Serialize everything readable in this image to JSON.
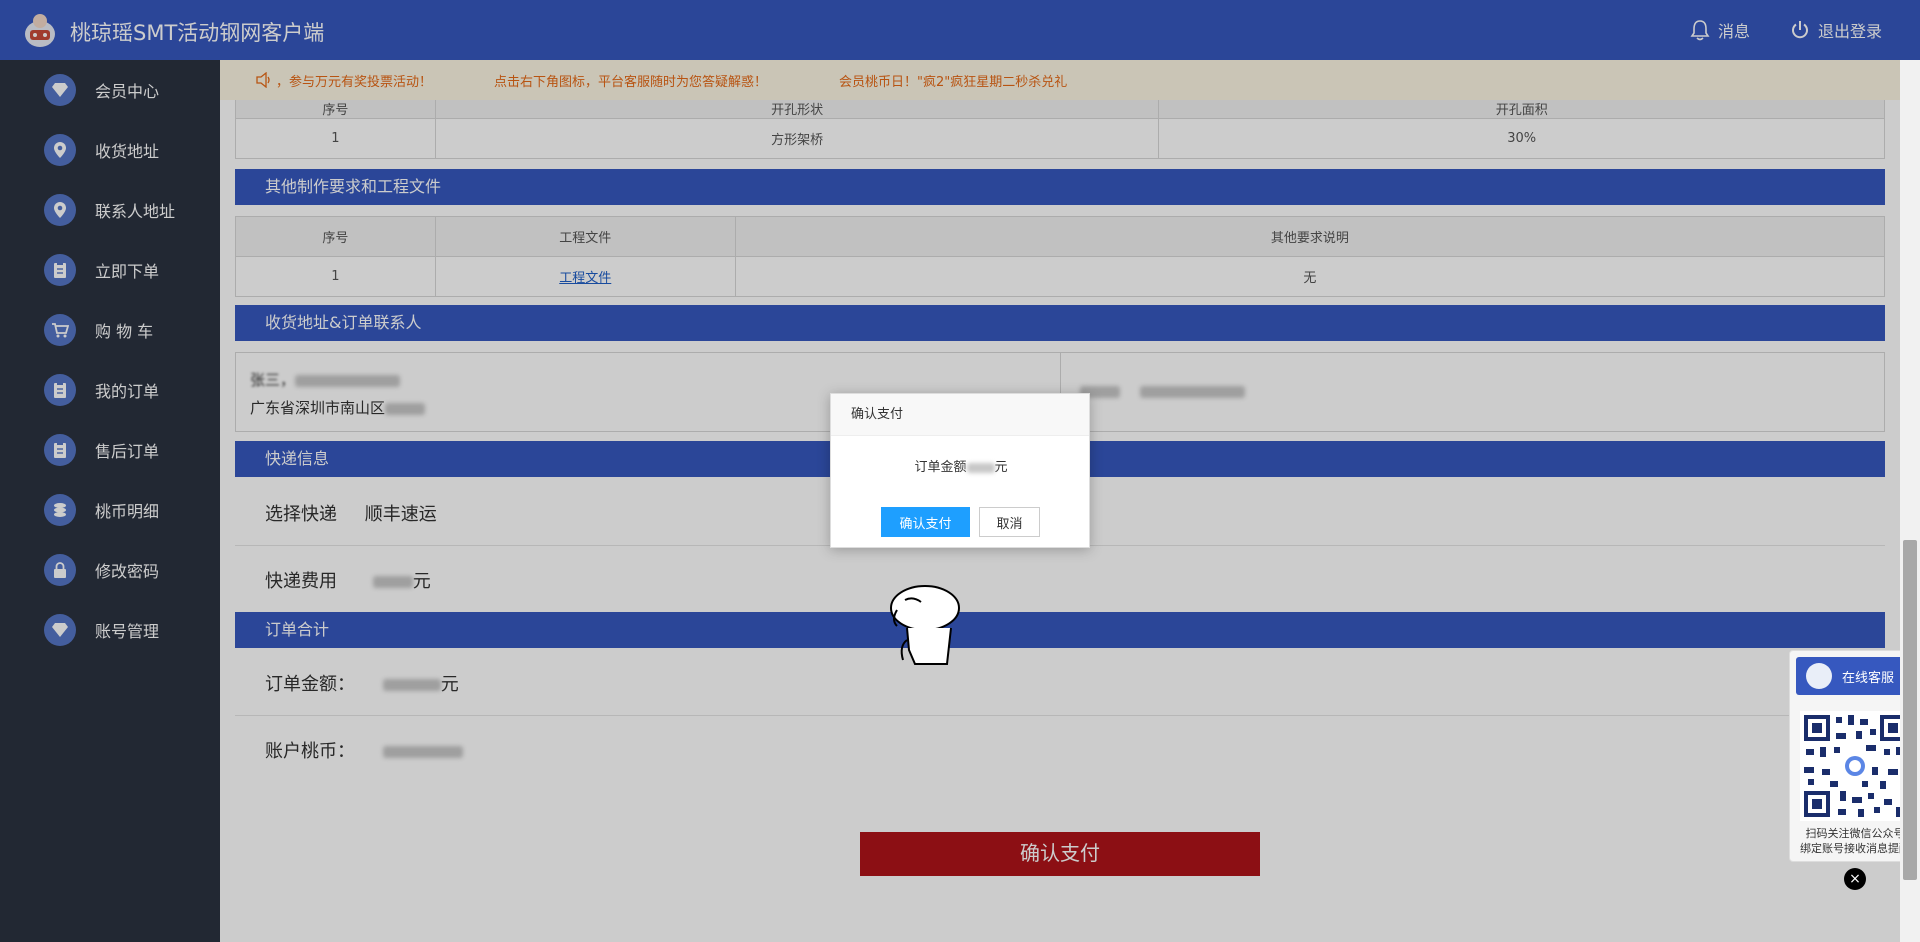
{
  "header": {
    "title": "桃琼瑶SMT活动钢网客户端",
    "messages_label": "消息",
    "logout_label": "退出登录"
  },
  "sidebar": {
    "items": [
      {
        "label": "会员中心",
        "icon": "diamond-icon"
      },
      {
        "label": "收货地址",
        "icon": "location-pin-icon"
      },
      {
        "label": "联系人地址",
        "icon": "location-pin-icon"
      },
      {
        "label": "立即下单",
        "icon": "clipboard-icon"
      },
      {
        "label": "购 物 车",
        "icon": "cart-icon"
      },
      {
        "label": "我的订单",
        "icon": "clipboard-icon"
      },
      {
        "label": "售后订单",
        "icon": "clipboard-icon"
      },
      {
        "label": "桃币明细",
        "icon": "coins-icon"
      },
      {
        "label": "修改密码",
        "icon": "lock-icon"
      },
      {
        "label": "账号管理",
        "icon": "diamond-icon"
      }
    ]
  },
  "notice": {
    "items": [
      "，参与万元有奖投票活动！",
      "点击右下角图标，平台客服随时为您答疑解惑！",
      "会员桃币日！\"疯2\"疯狂星期二秒杀兑礼"
    ]
  },
  "opening_table": {
    "headers": [
      "序号",
      "开孔形状",
      "开孔面积"
    ],
    "rows": [
      [
        "1",
        "方形架桥",
        "30%"
      ]
    ]
  },
  "other_requirements": {
    "title": "其他制作要求和工程文件",
    "headers": [
      "序号",
      "工程文件",
      "其他要求说明"
    ],
    "rows": [
      {
        "index": "1",
        "file_link": "工程文件",
        "note": "无"
      }
    ]
  },
  "address_section": {
    "title": "收货地址&订单联系人",
    "name_phone": "张三，",
    "address": "广东省深圳市南山区"
  },
  "shipping": {
    "title": "快递信息",
    "courier_label": "选择快递",
    "courier_value": "顺丰速运",
    "fee_label": "快递费用",
    "fee_suffix": "元"
  },
  "order_total": {
    "title": "订单合计",
    "amount_label": "订单金额：",
    "amount_suffix": "元",
    "balance_label": "账户桃币：",
    "pay_button": "确认支付"
  },
  "dialog": {
    "title": "确认支付",
    "message_prefix": "订单金额",
    "message_suffix": "元",
    "confirm_label": "确认支付",
    "cancel_label": "取消"
  },
  "service": {
    "head_label": "在线客服",
    "text_line1": "扫码关注微信公众号",
    "text_line2": "绑定账号接收消息提醒",
    "close_label": "×"
  },
  "colors": {
    "brand_blue": "#3658bf",
    "sidebar_bg": "#2b3240",
    "pay_red": "#b0131a",
    "dialog_blue": "#1e9fff",
    "notice_orange": "#e66a17"
  }
}
